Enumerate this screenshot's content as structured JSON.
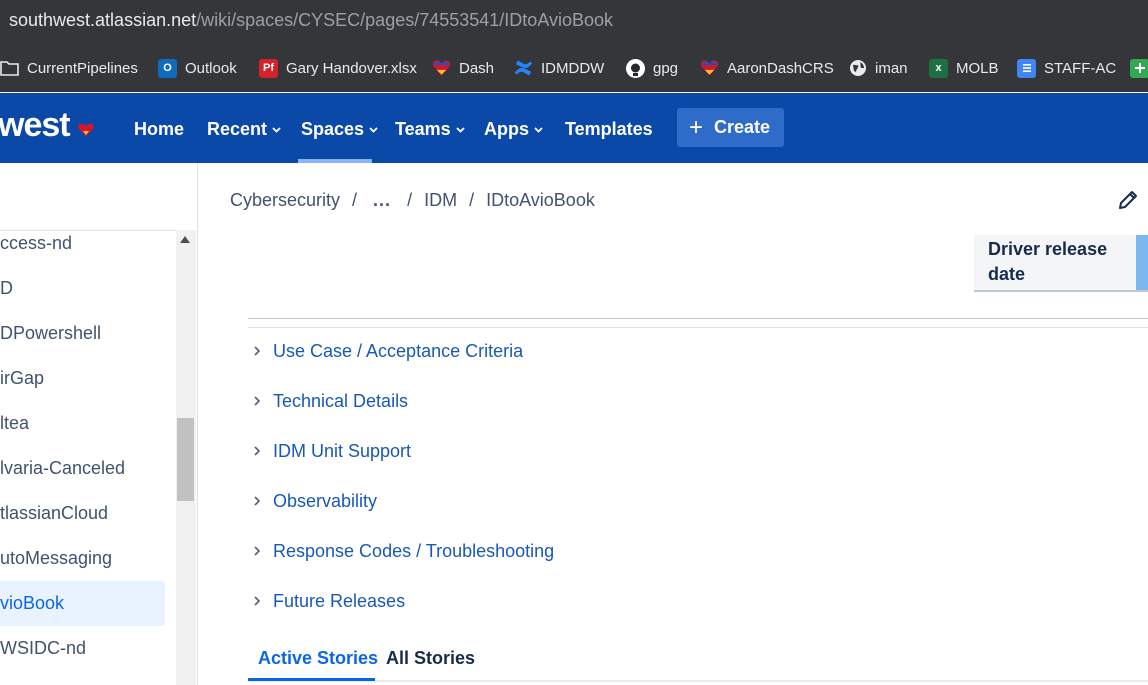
{
  "browser": {
    "url_host": "southwest.atlassian.net",
    "url_path": "/wiki/spaces/CYSEC/pages/74553541/IDtoAvioBook"
  },
  "bookmarks": [
    {
      "label": "CurrentPipelines",
      "icon": "folder-icon"
    },
    {
      "label": "Outlook",
      "icon": "outlook-icon"
    },
    {
      "label": "Gary Handover.xlsx",
      "icon": "pdf-icon"
    },
    {
      "label": "Dash",
      "icon": "southwest-heart-icon"
    },
    {
      "label": "IDMDDW",
      "icon": "confluence-icon"
    },
    {
      "label": "gpg",
      "icon": "github-icon"
    },
    {
      "label": "AaronDashCRS",
      "icon": "southwest-heart-icon"
    },
    {
      "label": "iman",
      "icon": "globe-icon"
    },
    {
      "label": "MOLB",
      "icon": "excel-icon"
    },
    {
      "label": "STAFF-AC",
      "icon": "docs-icon"
    }
  ],
  "nav": {
    "logo": "west",
    "items": [
      "Home",
      "Recent",
      "Spaces",
      "Teams",
      "Apps",
      "Templates"
    ],
    "create_label": "Create",
    "colors": {
      "nav_bg": "#0b49a8",
      "create_bg": "#2f6bc8"
    }
  },
  "sidebar": {
    "items": [
      {
        "label": "ccess-nd"
      },
      {
        "label": "D"
      },
      {
        "label": "DPowershell"
      },
      {
        "label": "irGap"
      },
      {
        "label": "ltea"
      },
      {
        "label": "lvaria-Canceled"
      },
      {
        "label": "tlassianCloud"
      },
      {
        "label": "utoMessaging"
      },
      {
        "label": "vioBook",
        "selected": true
      },
      {
        "label": "WSIDC-nd"
      }
    ]
  },
  "breadcrumb": {
    "items": [
      "Cybersecurity",
      "...",
      "IDM",
      "IDtoAvioBook"
    ],
    "separator": "/"
  },
  "table": {
    "header_cell": "Driver release date"
  },
  "sections": [
    "Use Case / Acceptance Criteria",
    "Technical Details",
    "IDM Unit Support",
    "Observability",
    "Response Codes / Troubleshooting",
    "Future Releases"
  ],
  "tabs": {
    "active": "Active Stories",
    "other": "All Stories"
  }
}
